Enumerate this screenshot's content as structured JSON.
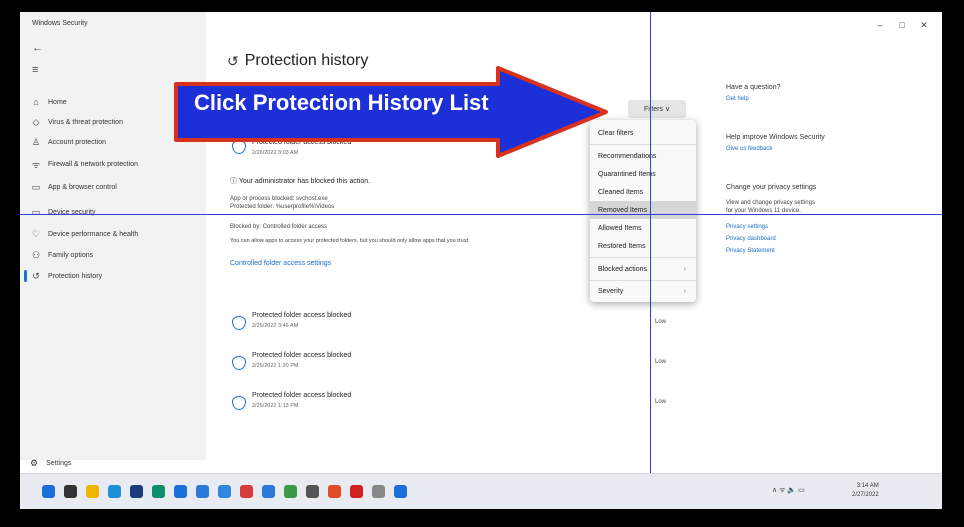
{
  "window": {
    "title": "Windows Security",
    "controls": [
      "–",
      "□",
      "✕"
    ]
  },
  "sidebar": {
    "back_icon": "←",
    "menu_icon": "≡",
    "items": [
      {
        "label": "Home",
        "icon": "home-icon",
        "glyph": "⌂"
      },
      {
        "label": "Virus & threat protection",
        "icon": "shield-icon",
        "glyph": "◇"
      },
      {
        "label": "Account protection",
        "icon": "person-icon",
        "glyph": "♙"
      },
      {
        "label": "Firewall & network protection",
        "icon": "wifi-icon",
        "glyph": "ᯤ"
      },
      {
        "label": "App & browser control",
        "icon": "window-icon",
        "glyph": "▭"
      },
      {
        "label": "Device security",
        "icon": "laptop-icon",
        "glyph": "▭"
      },
      {
        "label": "Device performance & health",
        "icon": "heart-icon",
        "glyph": "♡"
      },
      {
        "label": "Family options",
        "icon": "family-icon",
        "glyph": "⚇"
      },
      {
        "label": "Protection history",
        "icon": "history-icon",
        "glyph": "↺"
      }
    ],
    "settings_label": "Settings"
  },
  "page": {
    "title": "Protection history"
  },
  "callout": {
    "text": "Click Protection History List"
  },
  "filters": {
    "button_label": "Filters ∨",
    "menu": [
      {
        "label": "Clear filters",
        "chevron": ""
      },
      {
        "label": "Recommendations",
        "chevron": ""
      },
      {
        "label": "Quarantined Items",
        "chevron": ""
      },
      {
        "label": "Cleaned Items",
        "chevron": ""
      },
      {
        "label": "Removed Items",
        "chevron": ""
      },
      {
        "label": "Allowed Items",
        "chevron": ""
      },
      {
        "label": "Restored Items",
        "chevron": ""
      },
      {
        "label": "Blocked actions",
        "chevron": "›"
      },
      {
        "label": "Severity",
        "chevron": "›"
      }
    ],
    "selected_index": 4
  },
  "expanded_entry": {
    "title": "Protected folder access blocked",
    "date": "2/26/2022 3:03 AM",
    "admin_notice": "Your administrator has blocked this action.",
    "detail_1": "App or process blocked: svchost.exe",
    "detail_2": "Protected folder: %userprofile%\\Videos",
    "blocked_by": "Blocked by: Controlled folder access",
    "allow_text": "You can allow apps to access your protected folders, but you should only allow apps that you trust.",
    "settings_link": "Controlled folder access settings"
  },
  "entries": [
    {
      "title": "Protected folder access blocked",
      "date": "2/25/2022 3:46 AM",
      "severity": "Low"
    },
    {
      "title": "Protected folder access blocked",
      "date": "2/25/2022 1:20 PM",
      "severity": "Low"
    },
    {
      "title": "Protected folder access blocked",
      "date": "2/25/2022 1:13 PM",
      "severity": "Low"
    }
  ],
  "right_panel": {
    "question_heading": "Have a question?",
    "get_help": "Get help",
    "improve_heading": "Help improve Windows Security",
    "feedback": "Give us feedback",
    "privacy_heading": "Change your privacy settings",
    "privacy_text_1": "View and change privacy settings",
    "privacy_text_2": "for your Windows 11 device.",
    "privacy_settings": "Privacy settings",
    "privacy_dashboard": "Privacy dashboard",
    "privacy_statement": "Privacy Statement"
  },
  "taskbar": {
    "tray": "∧  ᯤ  🔈  ▭",
    "time": "3:14 AM",
    "date": "2/27/2022",
    "icon_colors": [
      "#1b6fd8",
      "#333333",
      "#f0b400",
      "#1b8fd8",
      "#1c3b7a",
      "#0a8f6a",
      "#1b6fd8",
      "#2a7ad8",
      "#2f88e0",
      "#d83b3b",
      "#2a7ad8",
      "#3a9a4a",
      "#555555",
      "#e24c2a",
      "#d02020",
      "#888888",
      "#1b6fd8"
    ]
  },
  "colors": {
    "accent": "#1a73d0",
    "callout_fill": "#1d2fd6",
    "callout_stroke": "#d8321e",
    "guide_line": "#2b44d8"
  }
}
